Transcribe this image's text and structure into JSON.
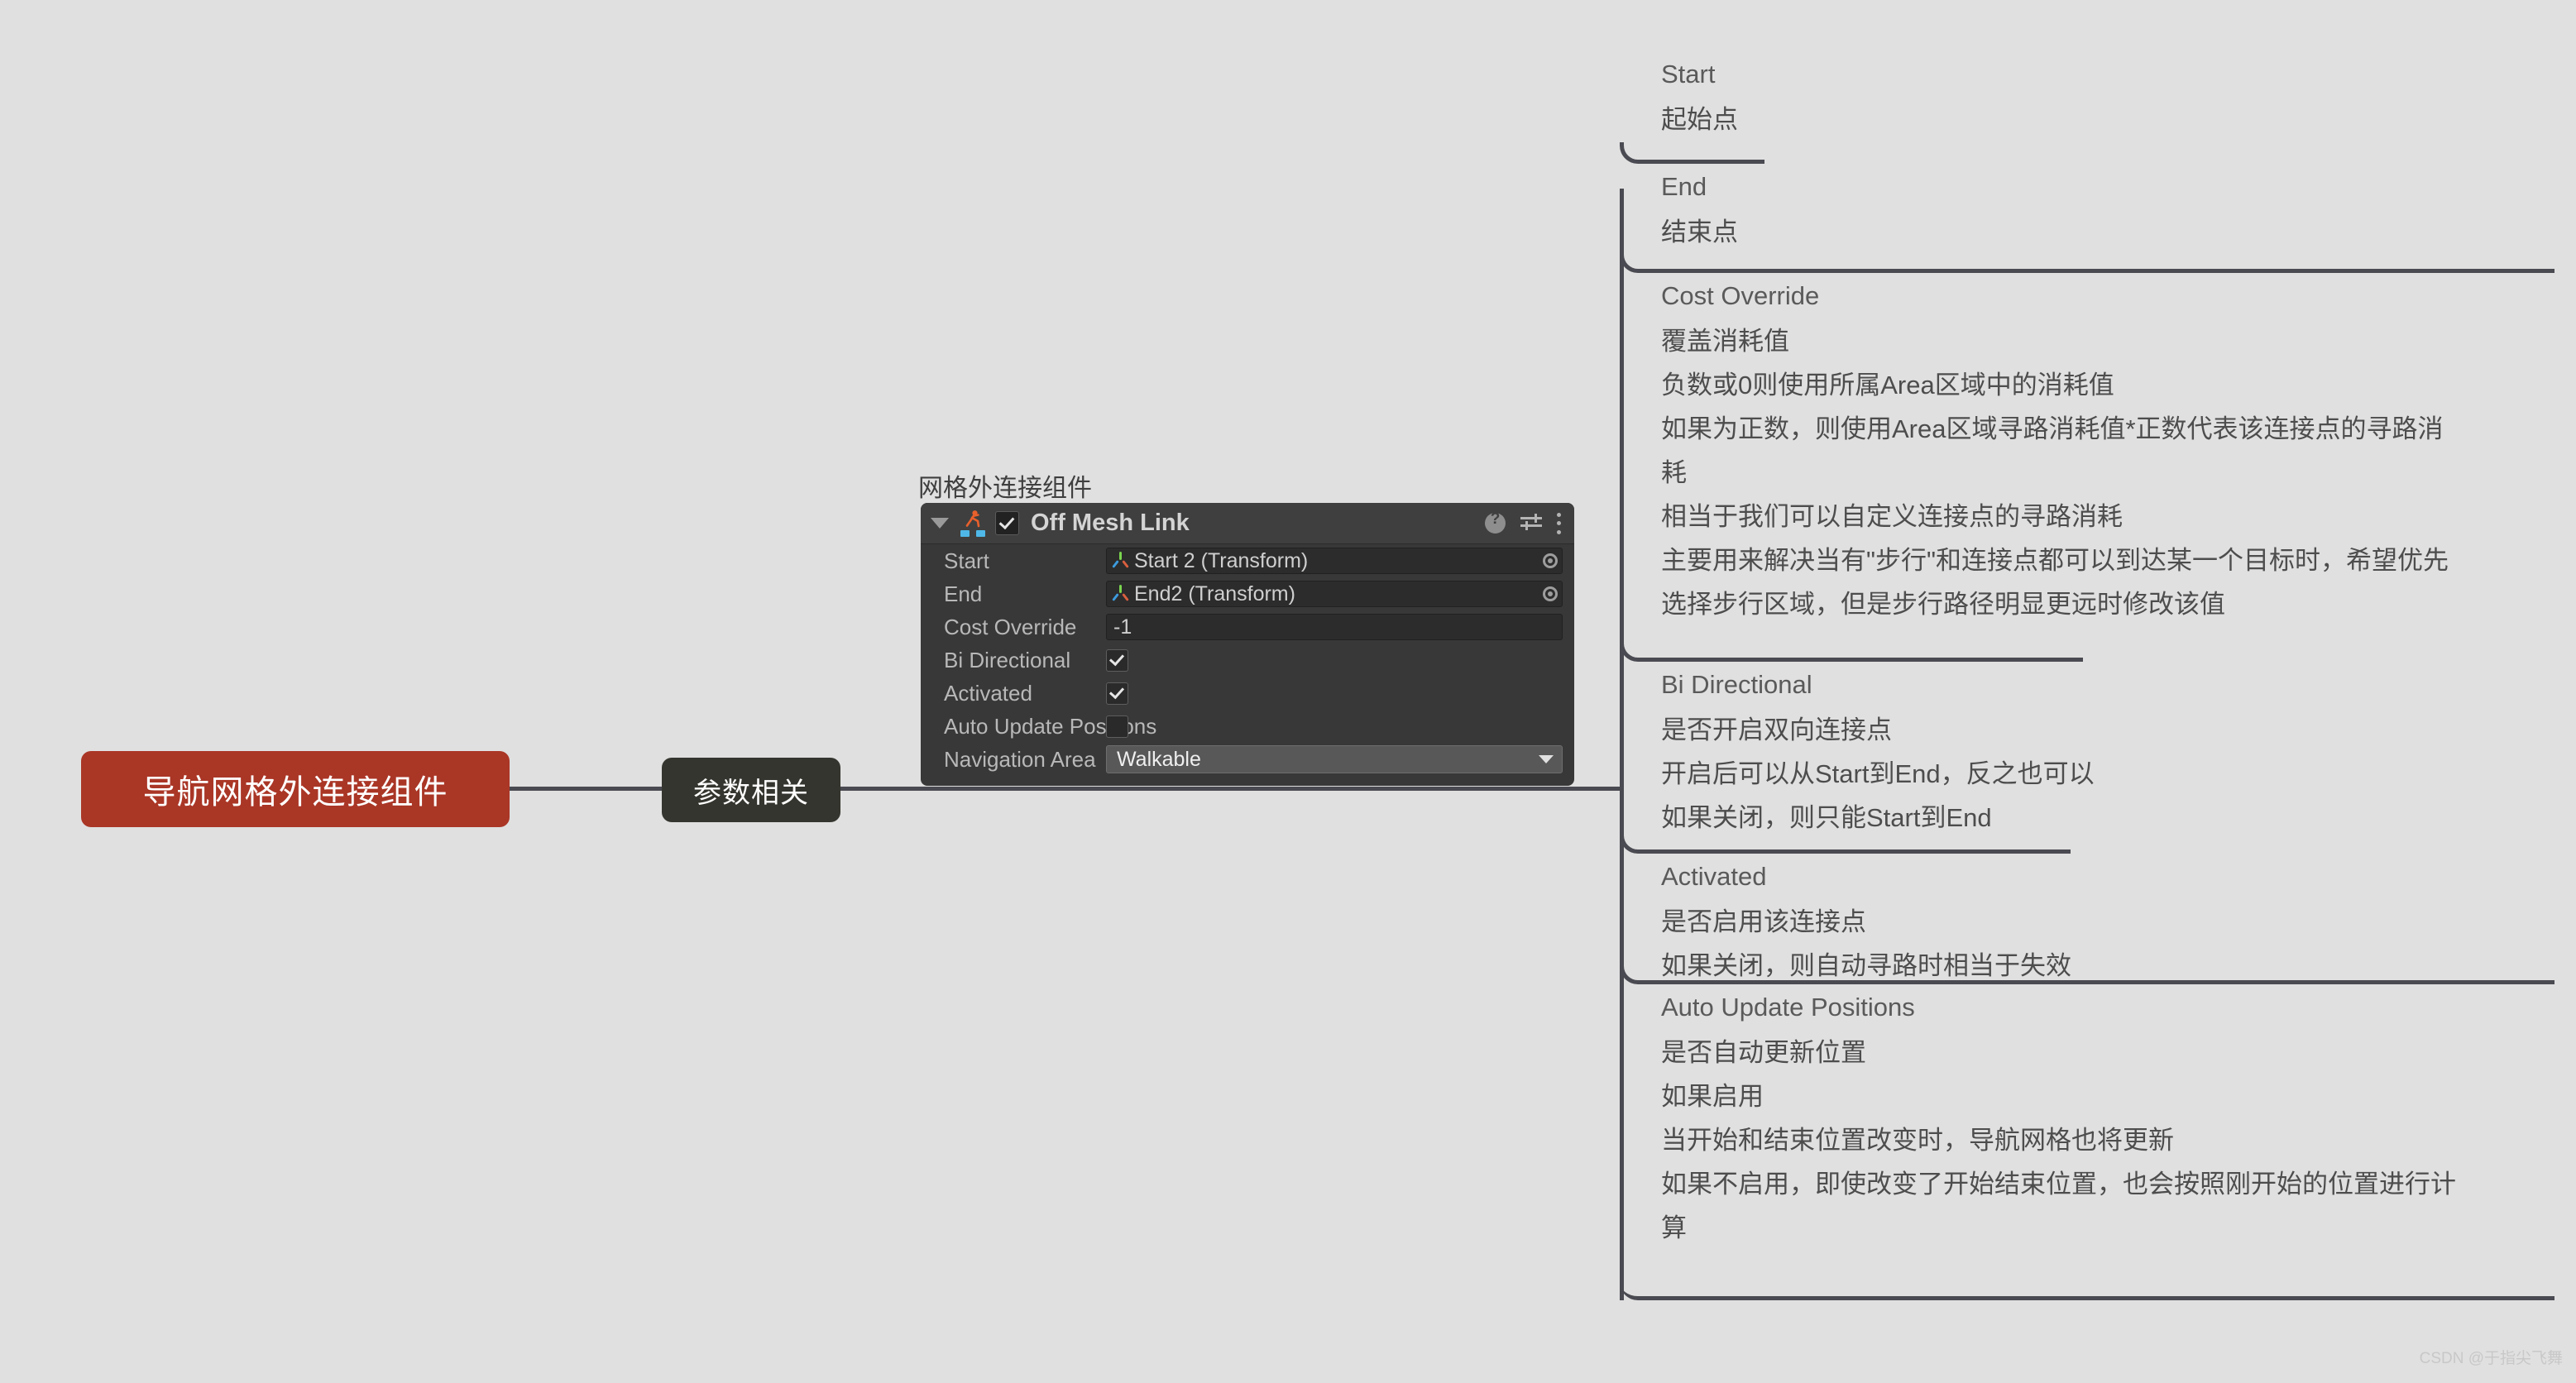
{
  "canvas": {
    "background_color": "#e0e0e0",
    "line_color": "#4a4a52"
  },
  "mindmap": {
    "root": {
      "label": "导航网格外连接组件",
      "color": "#aa3626"
    },
    "branch": {
      "label": "参数相关",
      "color": "#35352f"
    }
  },
  "unity_inspector": {
    "caption": "网格外连接组件",
    "component_title": "Off Mesh Link",
    "component_enabled": true,
    "icons": {
      "foldout": "triangle-down-icon",
      "component": "off-mesh-link-icon",
      "help": "help-icon",
      "preset": "preset-icon",
      "menu": "three-dots-icon"
    },
    "fields": [
      {
        "label": "Start",
        "type": "object",
        "value": "Start 2 (Transform)"
      },
      {
        "label": "End",
        "type": "object",
        "value": "End2 (Transform)"
      },
      {
        "label": "Cost Override",
        "type": "number",
        "value": "-1"
      },
      {
        "label": "Bi Directional",
        "type": "checkbox",
        "checked": true
      },
      {
        "label": "Activated",
        "type": "checkbox",
        "checked": true
      },
      {
        "label": "Auto Update Positions",
        "type": "checkbox",
        "checked": false
      },
      {
        "label": "Navigation Area",
        "type": "dropdown",
        "value": "Walkable"
      }
    ]
  },
  "annotations": [
    {
      "title": "Start",
      "lines": [
        "起始点"
      ]
    },
    {
      "title": "End",
      "lines": [
        "结束点"
      ]
    },
    {
      "title": "Cost Override",
      "lines": [
        "覆盖消耗值",
        "负数或0则使用所属Area区域中的消耗值",
        "如果为正数，则使用Area区域寻路消耗值*正数代表该连接点的寻路消",
        "耗",
        "相当于我们可以自定义连接点的寻路消耗",
        "主要用来解决当有\"步行\"和连接点都可以到达某一个目标时，希望优先",
        "选择步行区域，但是步行路径明显更远时修改该值"
      ]
    },
    {
      "title": "Bi Directional",
      "lines": [
        "是否开启双向连接点",
        "开启后可以从Start到End，反之也可以",
        "如果关闭，则只能Start到End"
      ]
    },
    {
      "title": "Activated",
      "lines": [
        "是否启用该连接点",
        "如果关闭，则自动寻路时相当于失效"
      ]
    },
    {
      "title": "Auto Update Positions",
      "lines": [
        "是否自动更新位置",
        "如果启用",
        "当开始和结束位置改变时，导航网格也将更新",
        "如果不启用，即使改变了开始结束位置，也会按照刚开始的位置进行计",
        "算"
      ]
    }
  ],
  "watermark": "CSDN @于指尖飞舞"
}
